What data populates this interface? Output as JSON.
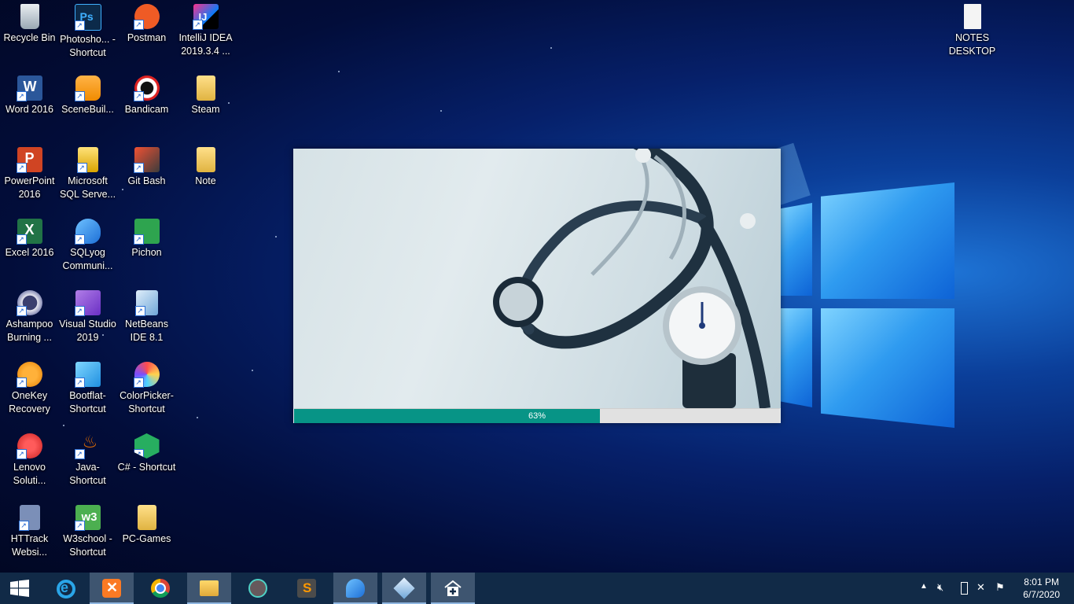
{
  "desktop": {
    "icons": [
      {
        "label": "Recycle Bin",
        "icon": "recycle-bin-icon"
      },
      {
        "label": "Photosho... - Shortcut",
        "icon": "photoshop-icon"
      },
      {
        "label": "Postman",
        "icon": "postman-icon"
      },
      {
        "label": "IntelliJ IDEA 2019.3.4 ...",
        "icon": "intellij-icon"
      },
      {
        "label": "NOTES DESKTOP",
        "icon": "text-file-icon"
      },
      {
        "label": "Word 2016",
        "icon": "word-icon"
      },
      {
        "label": "SceneBuil...",
        "icon": "scenebuilder-icon"
      },
      {
        "label": "Bandicam",
        "icon": "bandicam-icon"
      },
      {
        "label": "Steam",
        "icon": "folder-icon"
      },
      {
        "label": "PowerPoint 2016",
        "icon": "powerpoint-icon"
      },
      {
        "label": "Microsoft SQL Serve...",
        "icon": "sql-server-icon"
      },
      {
        "label": "Git Bash",
        "icon": "git-icon"
      },
      {
        "label": "Note",
        "icon": "folder-icon"
      },
      {
        "label": "Excel 2016",
        "icon": "excel-icon"
      },
      {
        "label": "SQLyog Communi...",
        "icon": "sqlyog-icon"
      },
      {
        "label": "Pichon",
        "icon": "pichon-icon"
      },
      {
        "label": "Ashampoo Burning ...",
        "icon": "ashampoo-icon"
      },
      {
        "label": "Visual Studio 2019",
        "icon": "visual-studio-icon"
      },
      {
        "label": "NetBeans IDE 8.1",
        "icon": "netbeans-icon"
      },
      {
        "label": "OneKey Recovery",
        "icon": "onekey-icon"
      },
      {
        "label": "Bootflat- Shortcut",
        "icon": "bootflat-icon"
      },
      {
        "label": "ColorPicker- Shortcut",
        "icon": "colorpicker-icon"
      },
      {
        "label": "Lenovo Soluti...",
        "icon": "lenovo-icon"
      },
      {
        "label": "Java- Shortcut",
        "icon": "java-icon"
      },
      {
        "label": "C# - Shortcut",
        "icon": "csharp-icon"
      },
      {
        "label": "HTTrack Websi...",
        "icon": "httrack-icon"
      },
      {
        "label": "W3school - Shortcut",
        "icon": "w3school-icon"
      },
      {
        "label": "PC-Games",
        "icon": "folder-icon"
      }
    ]
  },
  "splash": {
    "image": "stethoscope-photo",
    "progress_percent": 63,
    "progress_text": "63%",
    "progress_color": "#079486"
  },
  "taskbar": {
    "start_icon": "windows-start-icon",
    "pinned": [
      {
        "icon": "internet-explorer-icon",
        "active": false
      },
      {
        "icon": "xampp-icon",
        "active": true
      },
      {
        "icon": "chrome-icon",
        "active": false
      },
      {
        "icon": "file-explorer-icon",
        "active": true
      },
      {
        "icon": "atom-icon",
        "active": false
      },
      {
        "icon": "sublime-text-icon",
        "active": false
      },
      {
        "icon": "sqlyog-icon",
        "active": true
      },
      {
        "icon": "virtualbox-icon",
        "active": true
      },
      {
        "icon": "medical-app-icon",
        "active": true
      }
    ],
    "tray_icons": [
      "chevron-up-icon",
      "volume-muted-icon",
      "battery-icon",
      "network-disconnected-icon",
      "action-center-flag-icon"
    ],
    "time": "8:01 PM",
    "date": "6/7/2020"
  }
}
